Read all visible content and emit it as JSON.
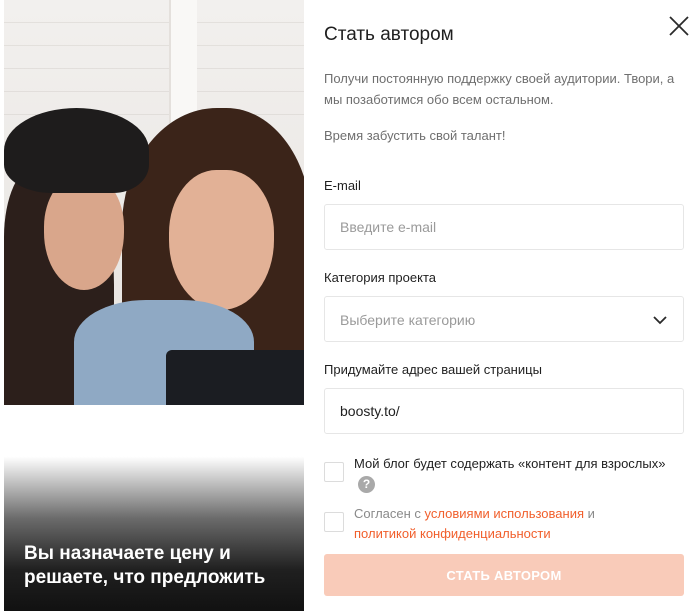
{
  "promo": {
    "caption": "Вы назначаете цену и решаете, что предложить"
  },
  "modal": {
    "title": "Стать автором",
    "description": "Получи постоянную поддержку своей аудитории. Твори, а мы позаботимся обо всем остальном.",
    "tagline": "Время забустить свой талант!",
    "close_icon": "close-icon"
  },
  "form": {
    "email": {
      "label": "E-mail",
      "placeholder": "Введите e-mail",
      "value": ""
    },
    "category": {
      "label": "Категория проекта",
      "placeholder": "Выберите категорию"
    },
    "page_address": {
      "label": "Придумайте адрес вашей страницы",
      "value": "boosty.to/"
    },
    "adult_content": {
      "label": "Мой блог будет содержать «контент для взрослых»",
      "help_icon": "?",
      "checked": false
    },
    "agree": {
      "prefix": "Согласен с",
      "terms_link": "условиями использования",
      "middle": "и",
      "privacy_link": "политикой конфиденциальности",
      "checked": false
    },
    "submit_label": "СТАТЬ АВТОРОМ"
  },
  "colors": {
    "accent": "#f15f2c",
    "button_disabled": "#f9cbb9"
  }
}
